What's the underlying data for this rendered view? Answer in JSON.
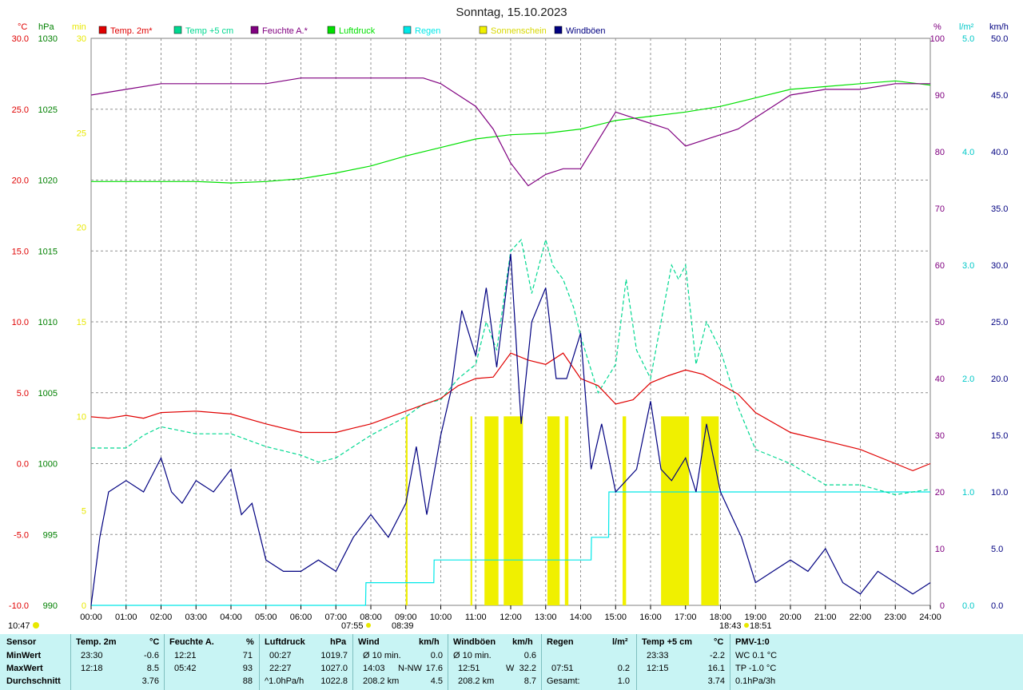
{
  "title": "Sonntag, 15.10.2023",
  "units_left": {
    "celsius": "°C",
    "hpa": "hPa",
    "min": "min"
  },
  "units_right": {
    "pct": "%",
    "lm2": "l/m²",
    "kmh": "km/h"
  },
  "legend": [
    {
      "label": "Temp. 2m*",
      "color": "#e00000"
    },
    {
      "label": "Temp +5 cm",
      "color": "#00d890"
    },
    {
      "label": "Feuchte A.*",
      "color": "#800080"
    },
    {
      "label": "Luftdruck",
      "color": "#00e000"
    },
    {
      "label": "Regen",
      "color": "#00e8e8"
    },
    {
      "label": "Sonnenschein",
      "color": "#f0f000"
    },
    {
      "label": "Windböen",
      "color": "#000080"
    }
  ],
  "sun": {
    "rise": "07:55",
    "transit": "08:39",
    "set": "18:43",
    "dusk": "18:51",
    "moon": "10:47"
  },
  "chart_data": {
    "type": "line",
    "x_ticks": [
      "00:00",
      "01:00",
      "02:00",
      "03:00",
      "04:00",
      "05:00",
      "06:00",
      "07:00",
      "08:00",
      "09:00",
      "10:00",
      "11:00",
      "12:00",
      "13:00",
      "14:00",
      "15:00",
      "16:00",
      "17:00",
      "18:00",
      "19:00",
      "20:00",
      "21:00",
      "22:00",
      "23:00",
      "24:00"
    ],
    "axes": {
      "temp_c": {
        "range": [
          -10,
          30
        ],
        "ticks": [
          "30.0",
          "25.0",
          "20.0",
          "15.0",
          "10.0",
          "5.0",
          "0.0",
          "-5.0",
          "-10.0"
        ],
        "color": "#e00000"
      },
      "pressure_hpa": {
        "range": [
          990,
          1030
        ],
        "ticks": [
          "1030",
          "1025",
          "1020",
          "1015",
          "1010",
          "1005",
          "1000",
          "995",
          "990"
        ],
        "color": "#008000"
      },
      "sun_min": {
        "range": [
          0,
          30
        ],
        "ticks": [
          "30",
          "25",
          "20",
          "15",
          "10",
          "5",
          "0"
        ],
        "color": "#e8e800"
      },
      "humidity_pct": {
        "range": [
          0,
          100
        ],
        "ticks": [
          "100",
          "90",
          "80",
          "70",
          "60",
          "50",
          "40",
          "30",
          "20",
          "10",
          "0"
        ],
        "color": "#800080"
      },
      "rain_lm2": {
        "range": [
          0,
          5
        ],
        "ticks": [
          "5.0",
          "4.0",
          "3.0",
          "2.0",
          "1.0",
          "0.0"
        ],
        "color": "#00c8c8"
      },
      "wind_kmh": {
        "range": [
          0,
          50
        ],
        "ticks": [
          "50.0",
          "45.0",
          "40.0",
          "35.0",
          "30.0",
          "25.0",
          "20.0",
          "15.0",
          "10.0",
          "5.0",
          "0.0"
        ],
        "color": "#000080"
      }
    },
    "series": [
      {
        "name": "Temp. 2m*",
        "axis": "temp_c",
        "x": [
          0,
          0.5,
          1,
          1.5,
          2,
          3,
          4,
          5,
          6,
          7,
          7.5,
          8,
          9,
          10,
          10.5,
          11,
          11.5,
          12,
          12.5,
          13,
          13.5,
          14,
          14.5,
          15,
          15.5,
          16,
          16.5,
          17,
          17.5,
          18,
          18.5,
          19,
          20,
          21,
          22,
          23,
          23.5,
          24
        ],
        "y": [
          3.3,
          3.2,
          3.4,
          3.2,
          3.6,
          3.7,
          3.5,
          2.8,
          2.2,
          2.2,
          2.5,
          2.8,
          3.7,
          4.6,
          5.5,
          6,
          6.1,
          7.8,
          7.3,
          7.0,
          7.8,
          6.0,
          5.5,
          4.2,
          4.5,
          5.7,
          6.2,
          6.6,
          6.3,
          5.6,
          4.9,
          3.6,
          2.2,
          1.6,
          1.0,
          0.0,
          -0.5,
          0.0
        ]
      },
      {
        "name": "Temp +5 cm",
        "axis": "temp_c",
        "x": [
          0,
          1,
          1.5,
          2,
          3,
          4,
          5,
          6,
          6.5,
          7,
          8,
          9,
          9.5,
          10,
          10.5,
          11,
          11.3,
          11.6,
          12,
          12.3,
          12.6,
          13,
          13.2,
          13.5,
          13.8,
          14,
          14.5,
          15,
          15.3,
          15.6,
          16,
          16.3,
          16.6,
          16.8,
          17,
          17.3,
          17.6,
          18,
          18.5,
          19,
          20,
          21,
          22,
          23,
          24
        ],
        "y": [
          1.1,
          1.1,
          2.0,
          2.6,
          2.1,
          2.1,
          1.2,
          0.6,
          0.1,
          0.4,
          2.0,
          3.3,
          4.2,
          4.5,
          6,
          7,
          10,
          8,
          15,
          15.8,
          12,
          15.8,
          14,
          13,
          11,
          9,
          5,
          7,
          13,
          8,
          6,
          10,
          14,
          13,
          14,
          7,
          10,
          8,
          4,
          1,
          0,
          -1.5,
          -1.5,
          -2.2,
          -1.8
        ]
      },
      {
        "name": "Feuchte A.*",
        "axis": "humidity_pct",
        "x": [
          0,
          1,
          2,
          3,
          4,
          5,
          6,
          7,
          8,
          9,
          9.5,
          10,
          10.5,
          11,
          11.5,
          12,
          12.5,
          13,
          13.5,
          14,
          14.5,
          15,
          15.5,
          16,
          16.5,
          17,
          17.5,
          18,
          18.5,
          19,
          20,
          21,
          22,
          23,
          24
        ],
        "y": [
          90,
          91,
          92,
          92,
          92,
          92,
          93,
          93,
          93,
          93,
          93,
          92,
          90,
          88,
          84,
          78,
          74,
          76,
          77,
          77,
          82,
          87,
          86,
          85,
          84,
          81,
          82,
          83,
          84,
          86,
          90,
          91,
          91,
          92,
          92
        ]
      },
      {
        "name": "Luftdruck",
        "axis": "pressure_hpa",
        "x": [
          0,
          1,
          2,
          3,
          4,
          5,
          6,
          7,
          8,
          9,
          10,
          11,
          12,
          13,
          14,
          15,
          16,
          17,
          18,
          19,
          20,
          21,
          22,
          23,
          24
        ],
        "y": [
          1019.9,
          1019.9,
          1019.9,
          1019.9,
          1019.8,
          1019.9,
          1020.1,
          1020.5,
          1021,
          1021.7,
          1022.3,
          1022.9,
          1023.2,
          1023.3,
          1023.6,
          1024.2,
          1024.5,
          1024.8,
          1025.2,
          1025.8,
          1026.4,
          1026.6,
          1026.8,
          1027.0,
          1026.7
        ]
      },
      {
        "name": "Regen",
        "axis": "rain_lm2",
        "x": [
          0,
          7.85,
          7.86,
          9.8,
          9.81,
          14.3,
          14.31,
          14.8,
          14.81,
          24
        ],
        "y": [
          0,
          0,
          0.2,
          0.2,
          0.4,
          0.4,
          0.6,
          0.6,
          1.0,
          1.0
        ]
      },
      {
        "name": "Windböen",
        "axis": "wind_kmh",
        "x": [
          0,
          0.25,
          0.5,
          1,
          1.5,
          2,
          2.3,
          2.6,
          3,
          3.5,
          4,
          4.3,
          4.6,
          5,
          5.5,
          6,
          6.5,
          7,
          7.5,
          8,
          8.5,
          9,
          9.3,
          9.6,
          10,
          10.3,
          10.6,
          11,
          11.3,
          11.6,
          12,
          12.3,
          12.6,
          13,
          13.3,
          13.6,
          14,
          14.3,
          14.6,
          15,
          15.3,
          15.6,
          16,
          16.3,
          16.6,
          17,
          17.3,
          17.6,
          18,
          18.3,
          18.6,
          19,
          19.5,
          20,
          20.5,
          21,
          21.5,
          22,
          22.5,
          23,
          23.5,
          24
        ],
        "y": [
          0,
          6,
          10,
          11,
          10,
          13,
          10,
          9,
          11,
          10,
          12,
          8,
          9,
          4,
          3,
          3,
          4,
          3,
          6,
          8,
          6,
          9,
          14,
          8,
          15,
          19,
          26,
          22,
          28,
          21,
          31,
          16,
          25,
          28,
          20,
          20,
          24,
          12,
          16,
          10,
          11,
          12,
          18,
          12,
          11,
          13,
          10,
          16,
          10,
          8,
          6,
          2,
          3,
          4,
          3,
          5,
          2,
          1,
          3,
          2,
          1,
          2
        ]
      }
    ],
    "sunshine_bars_min": [
      {
        "from": 9.0,
        "to": 9.05,
        "v": 10
      },
      {
        "from": 10.85,
        "to": 10.9,
        "v": 10
      },
      {
        "from": 11.25,
        "to": 11.65,
        "v": 10
      },
      {
        "from": 11.8,
        "to": 12.35,
        "v": 10
      },
      {
        "from": 13.05,
        "to": 13.4,
        "v": 10
      },
      {
        "from": 13.55,
        "to": 13.65,
        "v": 10
      },
      {
        "from": 15.2,
        "to": 15.3,
        "v": 10
      },
      {
        "from": 16.3,
        "to": 17.1,
        "v": 10
      },
      {
        "from": 17.45,
        "to": 17.95,
        "v": 10
      }
    ]
  },
  "stats": {
    "labels": {
      "sensor": "Sensor",
      "min": "MinWert",
      "max": "MaxWert",
      "avg": "Durchschnitt"
    },
    "temp2m": {
      "head": "Temp. 2m",
      "unit": "°C",
      "min_t": "23:30",
      "min_v": "-0.6",
      "max_t": "12:18",
      "max_v": "8.5",
      "avg_v": "3.76"
    },
    "feuchte": {
      "head": "Feuchte A.",
      "unit": "%",
      "min_t": "12:21",
      "min_v": "71",
      "max_t": "05:42",
      "max_v": "93",
      "avg_v": "88"
    },
    "luftdruck": {
      "head": "Luftdruck",
      "unit": "hPa",
      "min_t": "00:27",
      "min_v": "1019.7",
      "max_t": "22:27",
      "max_v": "1027.0",
      "avg_t": "^1.0hPa/h",
      "avg_v": "1022.8"
    },
    "wind": {
      "head": "Wind",
      "unit": "km/h",
      "min_t": "Ø 10 min.",
      "min_v": "0.0",
      "max_t": "14:03",
      "max_d": "N-NW",
      "max_v": "17.6",
      "avg_t": "208.2 km",
      "avg_v": "4.5"
    },
    "boeen": {
      "head": "Windböen",
      "unit": "km/h",
      "min_t": "Ø 10 min.",
      "min_v": "0.6",
      "max_t": "12:51",
      "max_d": "W",
      "max_v": "32.2",
      "avg_t": "208.2 km",
      "avg_v": "8.7"
    },
    "regen": {
      "head": "Regen",
      "unit": "l/m²",
      "max_t": "07:51",
      "max_v": "0.2",
      "avg_t": "Gesamt:",
      "avg_v": "1.0"
    },
    "temp5": {
      "head": "Temp +5 cm",
      "unit": "°C",
      "min_t": "23:33",
      "min_v": "-2.2",
      "max_t": "12:15",
      "max_v": "16.1",
      "avg_v": "3.74"
    },
    "pmv": {
      "head": "PMV-1:0",
      "min_v": "WC 0.1 °C",
      "max_v": "TP -1.0 °C",
      "avg_v": "0.1hPa/3h"
    }
  }
}
